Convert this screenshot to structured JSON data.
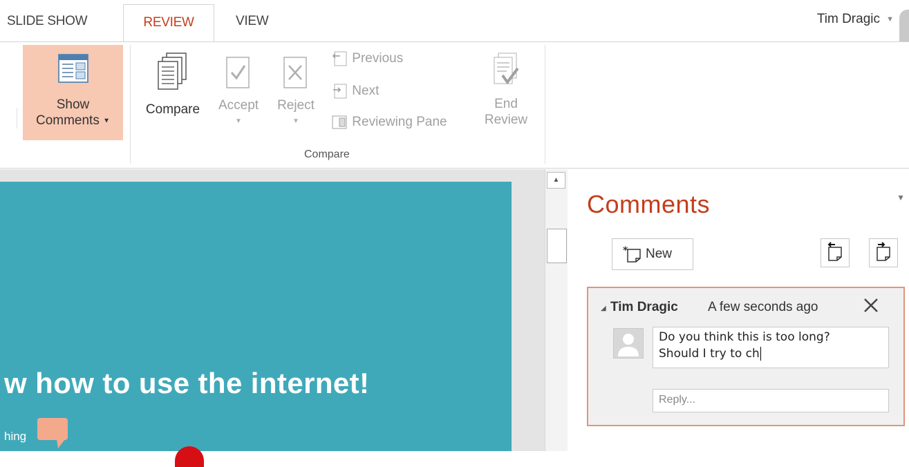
{
  "tabs": [
    {
      "label": "SLIDE SHOW"
    },
    {
      "label": "REVIEW"
    },
    {
      "label": "VIEW"
    }
  ],
  "user": {
    "name": "Tim Dragic"
  },
  "ribbon": {
    "show_comments": {
      "line1": "Show",
      "line2": "Comments"
    },
    "compare": "Compare",
    "accept": "Accept",
    "reject": "Reject",
    "previous": "Previous",
    "next": "Next",
    "reviewing_pane": "Reviewing Pane",
    "end_review": {
      "line1": "End",
      "line2": "Review"
    },
    "group_label": "Compare"
  },
  "slide": {
    "title": "w how to use the internet!",
    "subtitle": "hing"
  },
  "comments_pane": {
    "title": "Comments",
    "new_label": "New",
    "comment": {
      "author": "Tim Dragic",
      "time": "A few seconds ago",
      "text_line1": "Do you think this is too long?",
      "text_line2": "Should I try to ch",
      "reply_placeholder": "Reply..."
    }
  },
  "colors": {
    "accent": "#c43e1c",
    "slide_bg": "#40a9b9",
    "show_comments_bg": "#f7c8b2",
    "card_border": "#e0947c"
  }
}
